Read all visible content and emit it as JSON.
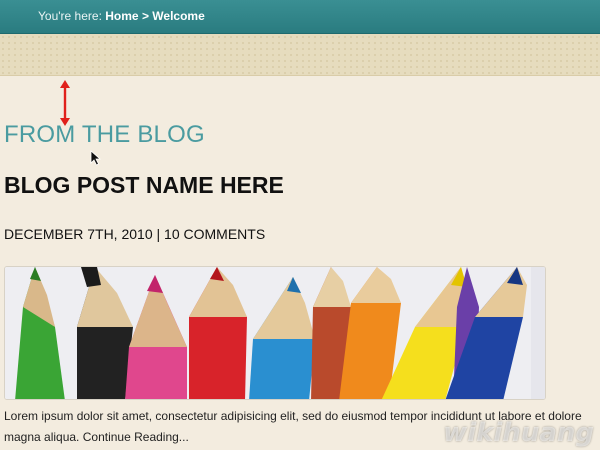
{
  "breadcrumb": {
    "prefix": "You're here:",
    "home": "Home",
    "separator": ">",
    "current": "Welcome"
  },
  "section": {
    "title": "FROM THE BLOG"
  },
  "post": {
    "title": "BLOG POST NAME HERE",
    "date": "DECEMBER 7TH, 2010",
    "meta_separator": "|",
    "comments": "10 COMMENTS",
    "excerpt": "Lorem ipsum dolor sit amet, consectetur adipisicing elit, sed do eiusmod tempor incididunt ut labore et dolore magna aliqua.",
    "more_link": "Continue Reading..."
  },
  "watermark": "wikihuang",
  "colors": {
    "topbar": "#2f8387",
    "section_title": "#4a9ba0",
    "page_background": "#f3ecdf",
    "annotation_arrow": "#e0201b"
  },
  "icons": {
    "annotation": "double-headed-arrow-icon",
    "pointer": "mouse-cursor-icon"
  }
}
